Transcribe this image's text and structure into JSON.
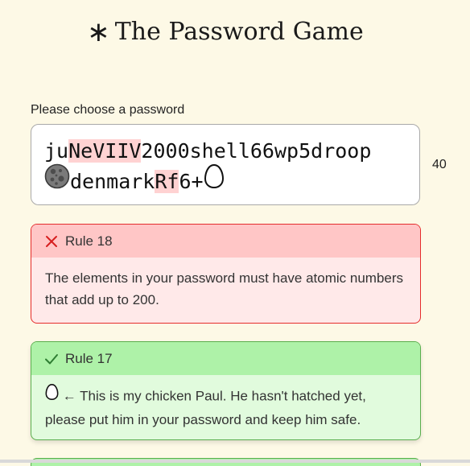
{
  "title": "The Password Game",
  "title_icon": "asterisk-icon",
  "password": {
    "label": "Please choose a password",
    "line1": [
      {
        "text": "ju",
        "hl": false
      },
      {
        "text": "NeVIIV",
        "hl": true
      },
      {
        "text": "2000shell66wp5droop",
        "hl": false
      }
    ],
    "line2": [
      {
        "text": "denmark",
        "hl": false
      },
      {
        "text": "Rf",
        "hl": true
      },
      {
        "text": "6+",
        "hl": false
      }
    ],
    "line2_leading_icon": "moon-icon",
    "line2_trailing_icon": "egg-icon",
    "char_count": "40"
  },
  "rules": [
    {
      "status": "fail",
      "status_icon": "cross-icon",
      "title": "Rule 18",
      "text": "The elements in your password must have atomic numbers that add up to 200."
    },
    {
      "status": "pass",
      "status_icon": "check-icon",
      "title": "Rule 17",
      "text": "← This is my chicken Paul. He hasn't hatched yet, please put him in your password and keep him safe.",
      "leading_icon": "egg-icon"
    }
  ],
  "colors": {
    "background": "#fdf9e6",
    "fail_border": "#e52c2c",
    "fail_header": "#ffc6c6",
    "fail_body": "#ffe9e9",
    "pass_border": "#5aae4d",
    "pass_header": "#aef2a8",
    "pass_body": "#e1fbdd",
    "highlight": "#ffd2d2"
  }
}
